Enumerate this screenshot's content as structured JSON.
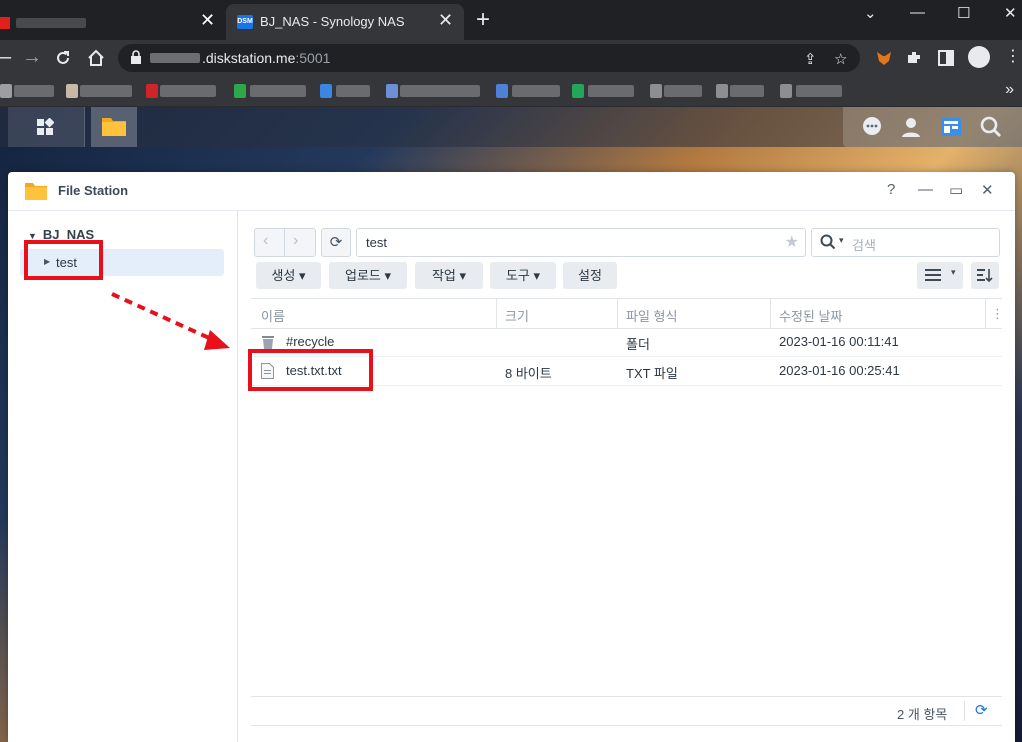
{
  "browser": {
    "active_tab_title": "BJ_NAS - Synology NAS",
    "active_tab_favicon": "DSM",
    "address": {
      "host": ".diskstation.me",
      "port": ":5001"
    }
  },
  "window": {
    "title": "File Station",
    "buttons": [
      "?",
      "—",
      "▭",
      "✕"
    ]
  },
  "sidebar": {
    "root": "BJ_NAS",
    "items": [
      {
        "label": "test"
      }
    ]
  },
  "path": {
    "value": "test"
  },
  "search": {
    "placeholder": "검색"
  },
  "actions": {
    "create": "생성",
    "upload": "업로드",
    "action": "작업",
    "tools": "도구",
    "settings": "설정"
  },
  "table": {
    "columns": [
      "이름",
      "크기",
      "파일 형식",
      "수정된 날짜"
    ],
    "rows": [
      {
        "name": "#recycle",
        "size": "",
        "type": "폴더",
        "modified": "2023-01-16 00:11:41",
        "icon": "trash-icon"
      },
      {
        "name": "test.txt.txt",
        "size": "8 바이트",
        "type": "TXT 파일",
        "modified": "2023-01-16 00:25:41",
        "icon": "document-icon"
      }
    ]
  },
  "footer": {
    "count": "2 개 항목"
  },
  "colors": {
    "highlight": "#e8101a",
    "accent": "#1a73e8"
  }
}
